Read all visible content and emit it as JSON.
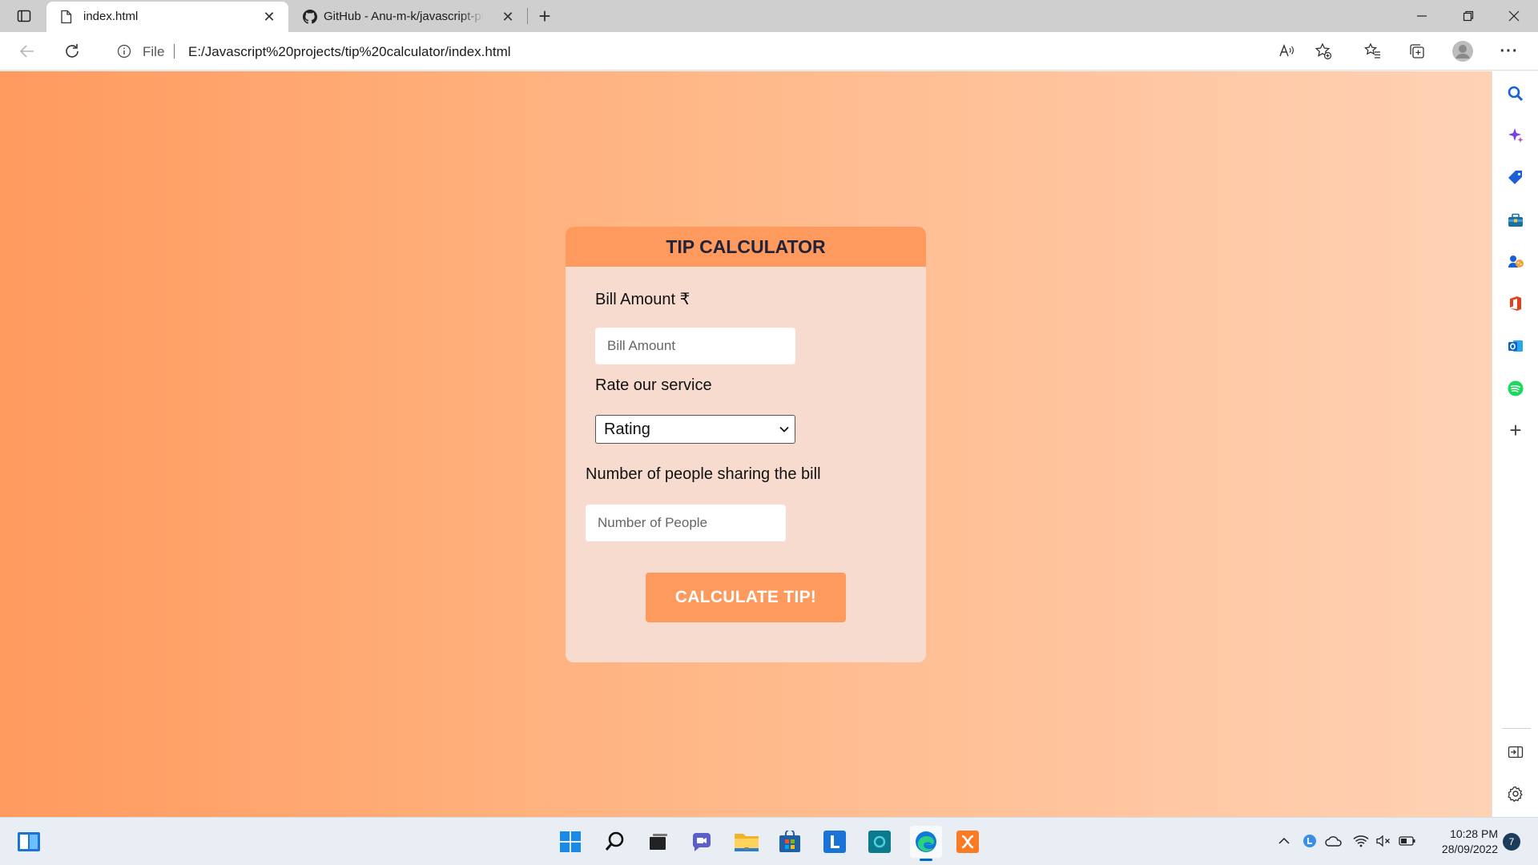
{
  "browser": {
    "tabs": [
      {
        "title": "index.html",
        "active": true
      },
      {
        "title": "GitHub - Anu-m-k/javascript-projects",
        "active": false
      }
    ],
    "address": {
      "scheme_label": "File",
      "url": "E:/Javascript%20projects/tip%20calculator/index.html"
    }
  },
  "app": {
    "title": "TIP CALCULATOR",
    "bill_label": "Bill Amount ₹",
    "bill_placeholder": "Bill Amount",
    "service_label": "Rate our service",
    "service_selected": "Rating",
    "people_label": "Number of people sharing the bill",
    "people_placeholder": "Number of People",
    "button_label": "CALCULATE TIP!"
  },
  "taskbar": {
    "time": "10:28 PM",
    "date": "28/09/2022",
    "notification_count": "7"
  },
  "colors": {
    "accent": "#ff9a5e",
    "card": "#f7dbce",
    "header_text": "#222238"
  }
}
